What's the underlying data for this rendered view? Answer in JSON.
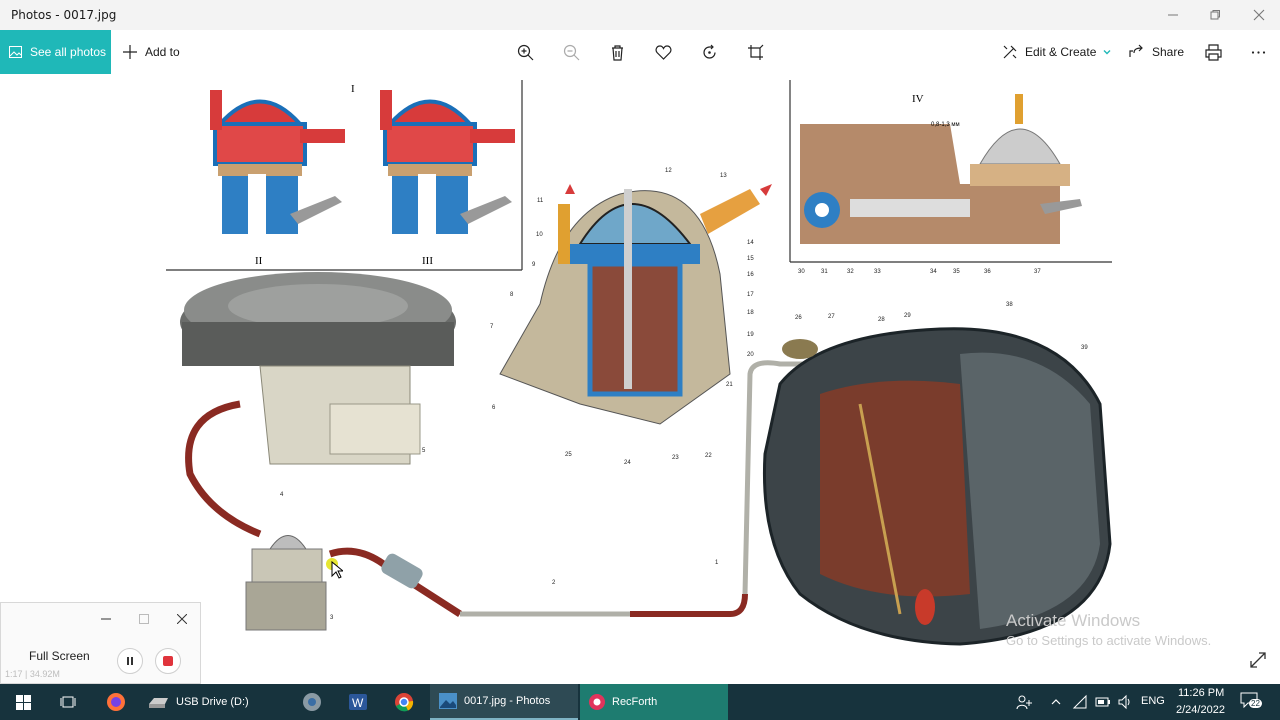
{
  "window": {
    "title": "Photos - 0017.jpg",
    "minimize_icon": "minimize-icon",
    "maximize_icon": "maximize-icon",
    "close_icon": "close-icon"
  },
  "toolbar": {
    "see_all_label": "See all photos",
    "add_to_label": "Add to",
    "edit_create_label": "Edit & Create",
    "share_label": "Share",
    "icons": [
      "zoom-in-icon",
      "zoom-out-icon",
      "delete-icon",
      "favorite-icon",
      "rotate-icon",
      "crop-icon",
      "print-icon",
      "more-icon"
    ],
    "accent": "#1fb8b8"
  },
  "image": {
    "panel_labels": [
      "I",
      "II",
      "III",
      "IV"
    ],
    "callouts": [
      "1",
      "2",
      "3",
      "4",
      "5",
      "6",
      "7",
      "8",
      "9",
      "10",
      "11",
      "12",
      "13",
      "14",
      "15",
      "16",
      "17",
      "18",
      "19",
      "20",
      "21",
      "22",
      "23",
      "24",
      "25",
      "26",
      "27",
      "28",
      "29",
      "30",
      "31",
      "32",
      "33",
      "34",
      "35",
      "36",
      "37",
      "38",
      "39"
    ],
    "dimension_label": "0,8-1,3 мм"
  },
  "recorder": {
    "label": "Full Screen",
    "meta": "1:17  | 34.92M",
    "buttons": [
      "pause-icon",
      "stop-icon"
    ]
  },
  "watermark": {
    "line1": "Activate Windows",
    "line2": "Go to Settings to activate Windows."
  },
  "taskbar": {
    "apps": [
      {
        "label": "USB Drive (D:)"
      },
      {
        "label": "0017.jpg - Photos"
      },
      {
        "label": "RecForth"
      }
    ],
    "language": "ENG",
    "time": "11:26 PM",
    "date": "2/24/2022",
    "notifications": "22"
  }
}
